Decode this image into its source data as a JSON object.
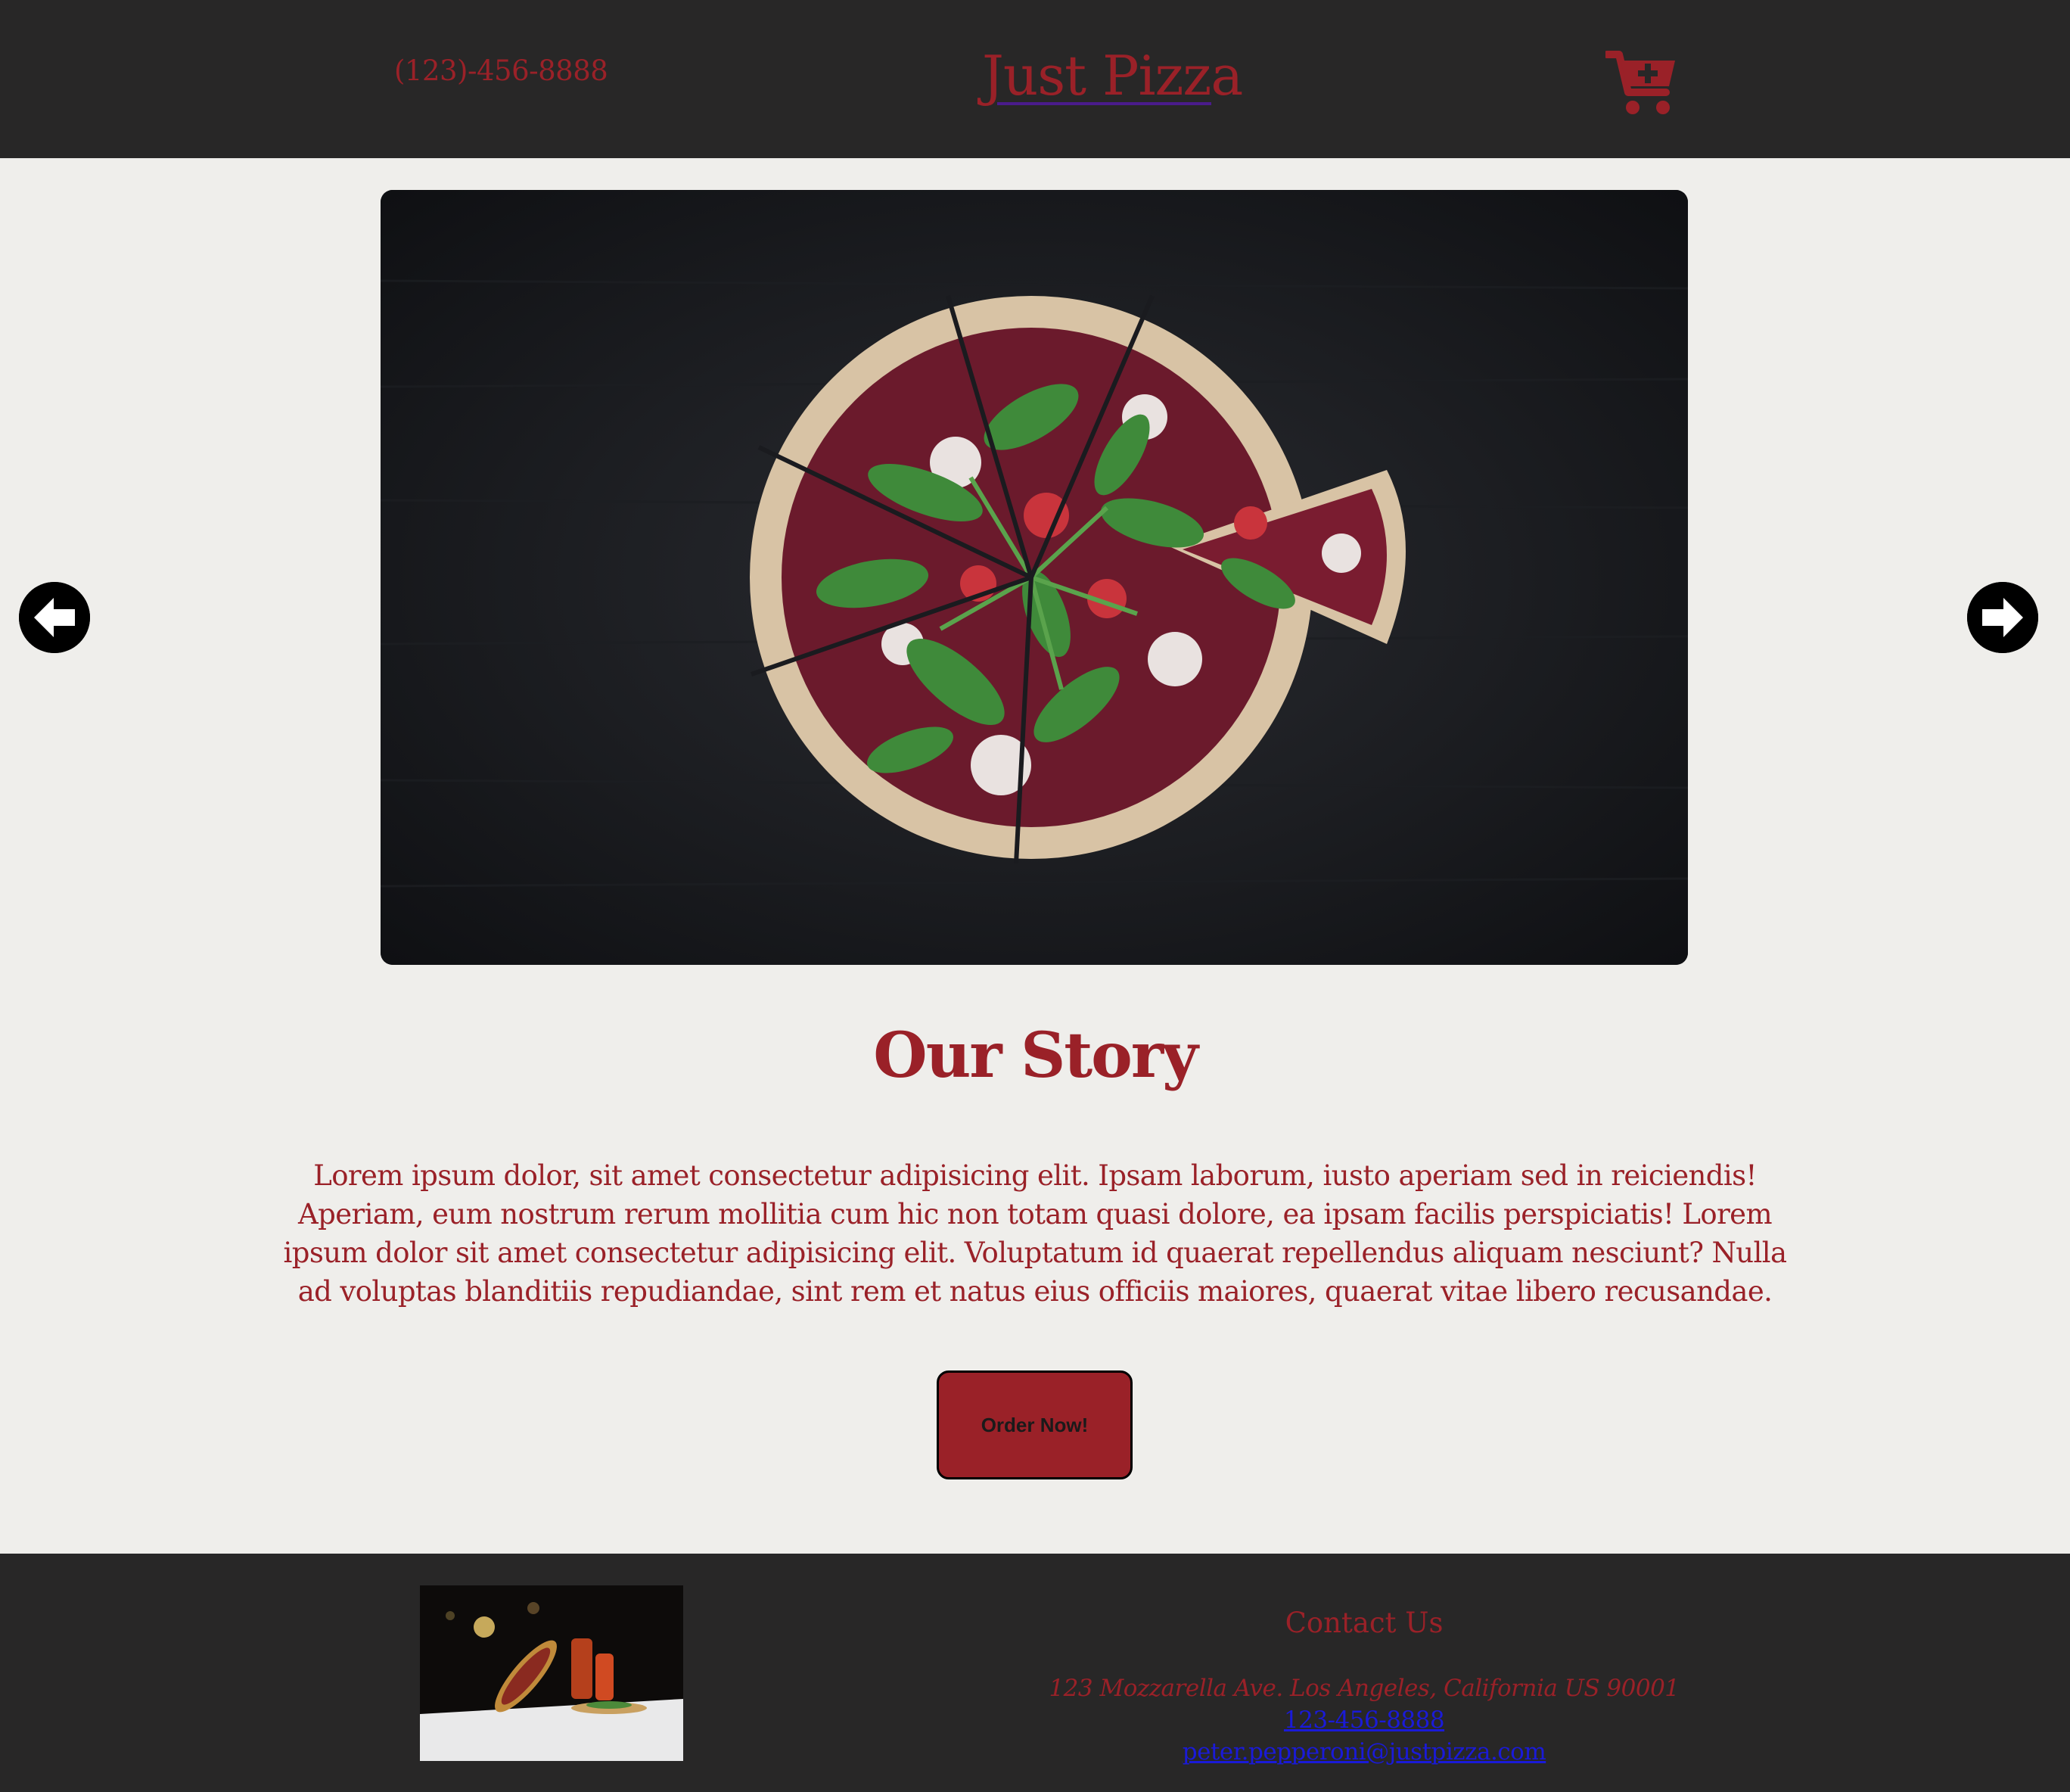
{
  "header": {
    "phone": "(123)-456-8888",
    "brand": "Just Pizza",
    "cart_icon": "cart-plus-icon"
  },
  "carousel": {
    "image": "pizza-on-dark-wood",
    "prev_icon": "arrow-circle-left-icon",
    "next_icon": "arrow-circle-right-icon"
  },
  "story": {
    "title": "Our Story",
    "text": "Lorem ipsum dolor, sit amet consectetur adipisicing elit. Ipsam laborum, iusto aperiam sed in reiciendis! Aperiam, eum nostrum rerum mollitia cum hic non totam quasi dolore, ea ipsam facilis perspiciatis! Lorem ipsum dolor sit amet consectetur adipisicing elit. Voluptatum id quaerat repellendus aliquam nesciunt? Nulla ad voluptas blanditiis repudiandae, sint rem et natus eius officiis maiores, quaerat vitae libero recusandae.",
    "order_label": "Order Now!"
  },
  "footer": {
    "image": "tossed-pizza-photo",
    "contact_title": "Contact Us",
    "address": "123 Mozzarella Ave. Los Angeles, California US 90001",
    "phone": "123-456-8888",
    "email": "peter.pepperoni@justpizza.com"
  },
  "colors": {
    "header_bg": "#282727",
    "page_bg": "#efeeeb",
    "accent": "#9a2128",
    "link": "#1a1ad8"
  }
}
